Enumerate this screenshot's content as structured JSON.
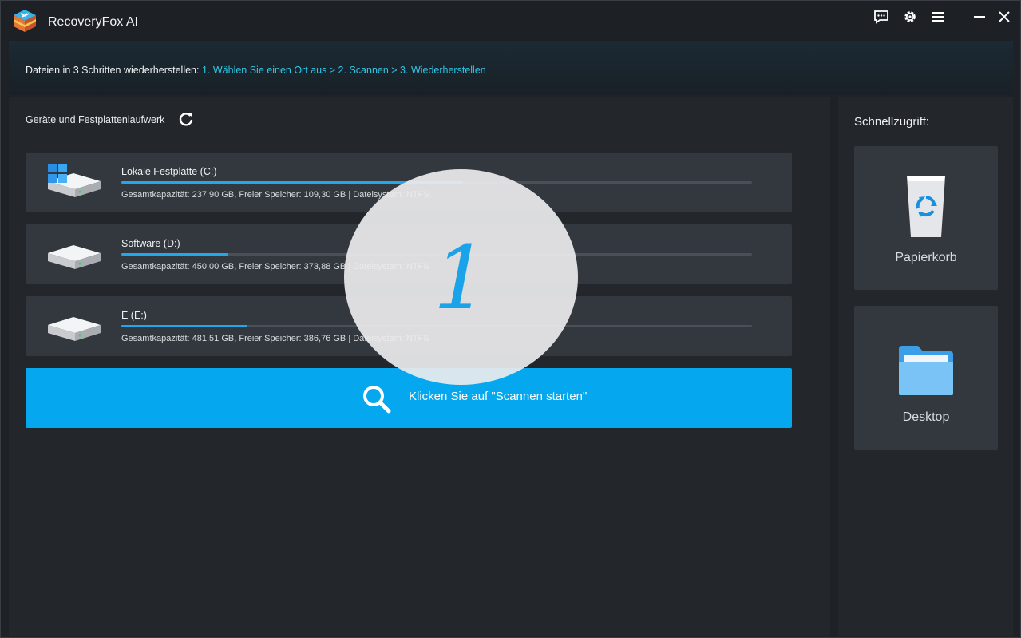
{
  "app": {
    "title": "RecoveryFox AI"
  },
  "toolbar": {
    "icons": [
      "chat-icon",
      "gear-icon",
      "menu-icon",
      "minimize-icon",
      "close-icon"
    ]
  },
  "steps": {
    "prefix": "Dateien in 3 Schritten wiederherstellen:",
    "sequence": "1. Wählen Sie einen Ort aus > 2. Scannen > 3. Wiederherstellen"
  },
  "devices": {
    "title": "Geräte und Festplattenlaufwerk",
    "drives": [
      {
        "name": "Lokale Festplatte (C:)",
        "info": "Gesamtkapazität: 237,90 GB, Freier Speicher: 109,30 GB | Dateisystem: NTFS",
        "used_fraction": 0.54,
        "icon": "windows-drive-icon"
      },
      {
        "name": "Software (D:)",
        "info": "Gesamtkapazität: 450,00 GB, Freier Speicher: 373,88 GB | Dateisystem: NTFS",
        "used_fraction": 0.17,
        "icon": "hard-drive-icon"
      },
      {
        "name": "E (E:)",
        "info": "Gesamtkapazität: 481,51 GB, Freier Speicher: 386,76 GB | Dateisystem: NTFS",
        "used_fraction": 0.2,
        "icon": "hard-drive-icon"
      }
    ]
  },
  "scan": {
    "label": "Klicken Sie auf \"Scannen starten\""
  },
  "overlay": {
    "step": "1"
  },
  "quick_access": {
    "title": "Schnellzugriff:",
    "items": [
      {
        "label": "Papierkorb",
        "icon": "recycle-bin-icon"
      },
      {
        "label": "Desktop",
        "icon": "folder-icon"
      }
    ]
  },
  "colors": {
    "accent": "#05a8ee",
    "steps_text": "#2ec6e6",
    "background": "#1e2125",
    "panel": "#23272c",
    "card": "#33383e"
  }
}
